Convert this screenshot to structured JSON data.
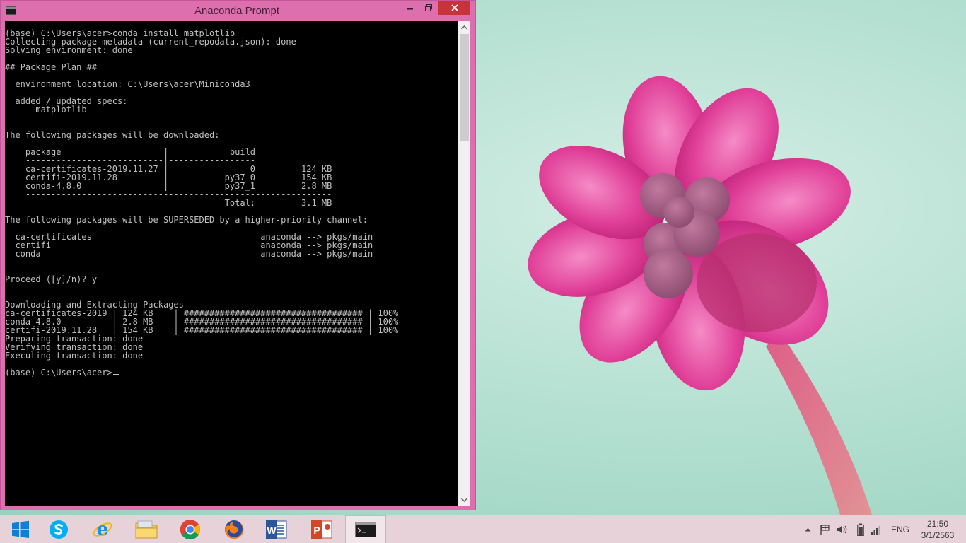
{
  "window": {
    "title": "Anaconda Prompt",
    "console_lines": [
      "(base) C:\\Users\\acer>conda install matplotlib",
      "Collecting package metadata (current_repodata.json): done",
      "Solving environment: done",
      "",
      "## Package Plan ##",
      "",
      "  environment location: C:\\Users\\acer\\Miniconda3",
      "",
      "  added / updated specs:",
      "    - matplotlib",
      "",
      "",
      "The following packages will be downloaded:",
      "",
      "    package                    |            build",
      "    ---------------------------|-----------------",
      "    ca-certificates-2019.11.27 |                0         124 KB",
      "    certifi-2019.11.28         |           py37_0         154 KB",
      "    conda-4.8.0                |           py37_1         2.8 MB",
      "    ------------------------------------------------------------",
      "                                           Total:         3.1 MB",
      "",
      "The following packages will be SUPERSEDED by a higher-priority channel:",
      "",
      "  ca-certificates                                 anaconda --> pkgs/main",
      "  certifi                                         anaconda --> pkgs/main",
      "  conda                                           anaconda --> pkgs/main",
      "",
      "",
      "Proceed ([y]/n)? y",
      "",
      "",
      "Downloading and Extracting Packages",
      "ca-certificates-2019 | 124 KB    | ################################### | 100%",
      "conda-4.8.0          | 2.8 MB    | ################################### | 100%",
      "certifi-2019.11.28   | 154 KB    | ################################### | 100%",
      "Preparing transaction: done",
      "Verifying transaction: done",
      "Executing transaction: done",
      ""
    ],
    "prompt": "(base) C:\\Users\\acer>"
  },
  "taskbar": {
    "apps": [
      {
        "name": "start-button",
        "icon": "windows-logo-icon"
      },
      {
        "name": "skype",
        "icon": "skype-icon"
      },
      {
        "name": "internet-explorer",
        "icon": "internet-explorer-icon"
      },
      {
        "name": "file-explorer",
        "icon": "folder-icon"
      },
      {
        "name": "chrome",
        "icon": "chrome-icon"
      },
      {
        "name": "firefox",
        "icon": "firefox-icon"
      },
      {
        "name": "word",
        "icon": "word-icon"
      },
      {
        "name": "powerpoint",
        "icon": "powerpoint-icon"
      },
      {
        "name": "anaconda-prompt",
        "icon": "terminal-icon",
        "active": true
      }
    ],
    "language": "ENG",
    "time": "21:50",
    "date": "3/1/2563"
  },
  "colors": {
    "window_frame": "#de6fae",
    "close_button": "#c7333b",
    "console_bg": "#000000",
    "console_fg": "#c0c0c0",
    "taskbar": "#e7d2d9"
  }
}
